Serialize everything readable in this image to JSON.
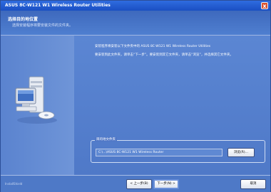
{
  "window": {
    "title": "ASUS 8C-W121 W1 Wireless Router Utilities",
    "close_glyph": "x"
  },
  "header": {
    "title": "选择目的地位置",
    "subtitle": "选择安装程序将要安装文件的文件夹。"
  },
  "main": {
    "paragraph1": "安装程序将安装以下文件夹中的 ASUS 8C-W121 W1 Wireless Router Utilities",
    "paragraph2": "要安装到此文件夹，请单击“下一步”。要安装到其它文件夹，请单击“浏览”，并选择其它文件夹。",
    "destination_label": "目的地文件夹",
    "destination_path": "C:\\...\\ASUS 8C-W121 W1 Wireless Router",
    "browse_label": "浏览(R)..."
  },
  "footer": {
    "brand": "InstallShield",
    "back_label": "< 上一步(B)",
    "next_label": "下一步(N) >",
    "cancel_label": "取消"
  }
}
